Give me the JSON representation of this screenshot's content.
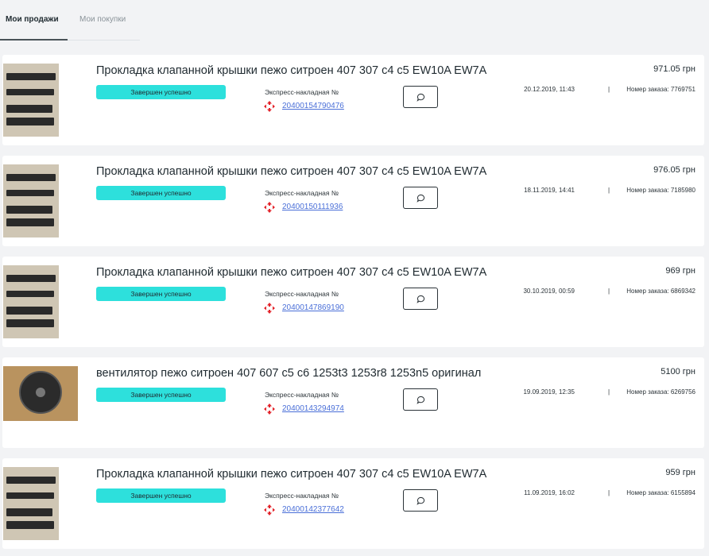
{
  "tabs": [
    {
      "label": "Мои продажи",
      "active": true
    },
    {
      "label": "Мои покупки",
      "active": false
    }
  ],
  "colors": {
    "badge": "#2de0dc",
    "link": "#4a6fd8",
    "carrier_icon": "#e3232a"
  },
  "orders": [
    {
      "title": "Прокладка клапанной крышки пежо ситроен 407 307 с4 с5 EW10A EW7A",
      "status": "Завершен успешно",
      "waybill_label": "Экспресс-накладная №",
      "waybill": "20400154790476",
      "price": "971.05 грн",
      "date": "20.12.2019, 11:43",
      "separator": "|",
      "order_number": "Номер заказа: 7769751",
      "image": "gasket"
    },
    {
      "title": "Прокладка клапанной крышки пежо ситроен 407 307 с4 с5 EW10A EW7A",
      "status": "Завершен успешно",
      "waybill_label": "Экспресс-накладная №",
      "waybill": "20400150111936",
      "price": "976.05 грн",
      "date": "18.11.2019, 14:41",
      "separator": "|",
      "order_number": "Номер заказа: 7185980",
      "image": "gasket"
    },
    {
      "title": "Прокладка клапанной крышки пежо ситроен 407 307 с4 с5 EW10A EW7A",
      "status": "Завершен успешно",
      "waybill_label": "Экспресс-накладная №",
      "waybill": "20400147869190",
      "price": "969 грн",
      "date": "30.10.2019, 00:59",
      "separator": "|",
      "order_number": "Номер заказа: 6869342",
      "image": "gasket"
    },
    {
      "title": "вентилятор пежо ситроен 407 607 с5 с6 1253t3 1253r8 1253n5 оригинал",
      "status": "Завершен успешно",
      "waybill_label": "Экспресс-накладная №",
      "waybill": "20400143294974",
      "price": "5100 грн",
      "date": "19.09.2019, 12:35",
      "separator": "|",
      "order_number": "Номер заказа: 6269756",
      "image": "fan"
    },
    {
      "title": "Прокладка клапанной крышки пежо ситроен 407 307 с4 с5 EW10A EW7A",
      "status": "Завершен успешно",
      "waybill_label": "Экспресс-накладная №",
      "waybill": "20400142377642",
      "price": "959 грн",
      "date": "11.09.2019, 16:02",
      "separator": "|",
      "order_number": "Номер заказа: 6155894",
      "image": "gasket"
    }
  ]
}
